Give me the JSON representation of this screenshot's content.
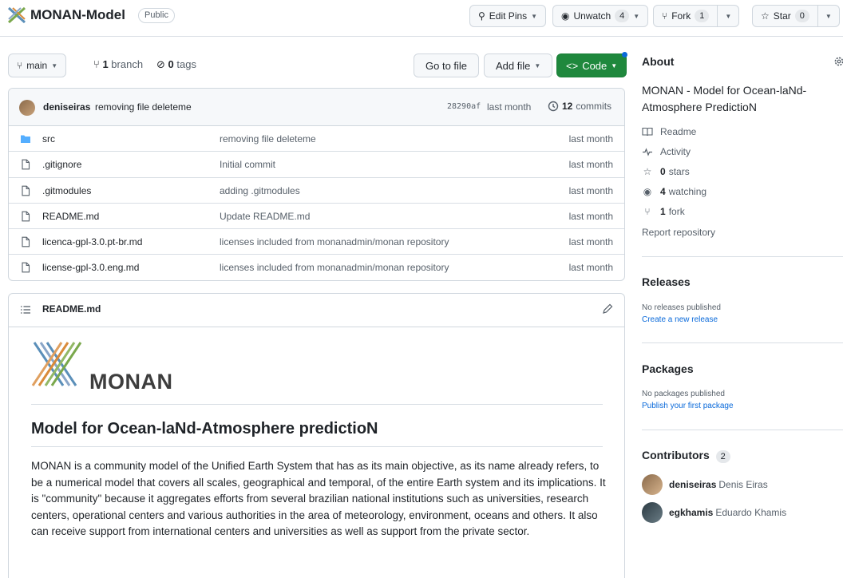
{
  "repo": {
    "name": "MONAN-Model",
    "visibility": "Public"
  },
  "header_actions": {
    "edit_pins_label": "Edit Pins",
    "unwatch_label": "Unwatch",
    "unwatch_count": "4",
    "fork_label": "Fork",
    "fork_count": "1",
    "star_label": "Star",
    "star_count": "0"
  },
  "toolbar": {
    "branch": "main",
    "branches_count": "1",
    "branches_label": "branch",
    "tags_count": "0",
    "tags_label": "tags",
    "go_to_file_label": "Go to file",
    "add_file_label": "Add file",
    "code_label": "Code"
  },
  "latest_commit": {
    "author": "deniseiras",
    "message": "removing file deleteme",
    "sha": "28290af",
    "time": "last month",
    "commits_count": "12",
    "commits_label": "commits"
  },
  "files": [
    {
      "name": "src",
      "type": "folder",
      "commit": "removing file deleteme",
      "time": "last month"
    },
    {
      "name": ".gitignore",
      "type": "file",
      "commit": "Initial commit",
      "time": "last month"
    },
    {
      "name": ".gitmodules",
      "type": "file",
      "commit": "adding .gitmodules",
      "time": "last month"
    },
    {
      "name": "README.md",
      "type": "file",
      "commit": "Update README.md",
      "time": "last month"
    },
    {
      "name": "licenca-gpl-3.0.pt-br.md",
      "type": "file",
      "commit": "licenses included from monanadmin/monan repository",
      "time": "last month"
    },
    {
      "name": "license-gpl-3.0.eng.md",
      "type": "file",
      "commit": "licenses included from monanadmin/monan repository",
      "time": "last month"
    }
  ],
  "readme": {
    "filename": "README.md",
    "wordmark": "MONAN",
    "heading": "Model for Ocean-laNd-Atmosphere predictioN",
    "body": "MONAN is a community model of the Unified Earth System that has as its main objective, as its name already refers, to be a numerical model that covers all scales, geographical and temporal, of the entire Earth system and its implications. It is \"community\" because it aggregates efforts from several brazilian national institutions such as universities, research centers, operational centers and various authorities in the area of meteorology, environment, oceans and others. It also can receive support from international centers and universities as well as support from the private sector."
  },
  "about": {
    "title": "About",
    "description": "MONAN - Model for Ocean-laNd-Atmosphere PredictioN",
    "readme_label": "Readme",
    "activity_label": "Activity",
    "stars_count": "0",
    "stars_label": "stars",
    "watching_count": "4",
    "watching_label": "watching",
    "forks_count": "1",
    "forks_label": "fork",
    "report_label": "Report repository"
  },
  "releases": {
    "title": "Releases",
    "note": "No releases published",
    "link": "Create a new release"
  },
  "packages": {
    "title": "Packages",
    "note": "No packages published",
    "link": "Publish your first package"
  },
  "contributors": {
    "title": "Contributors",
    "count": "2",
    "people": [
      {
        "login": "deniseiras",
        "name": "Denis Eiras"
      },
      {
        "login": "egkhamis",
        "name": "Eduardo Khamis"
      }
    ]
  },
  "colors": {
    "primary_green": "#1f883d",
    "link_blue": "#0969da",
    "folder_blue": "#54aeff"
  }
}
